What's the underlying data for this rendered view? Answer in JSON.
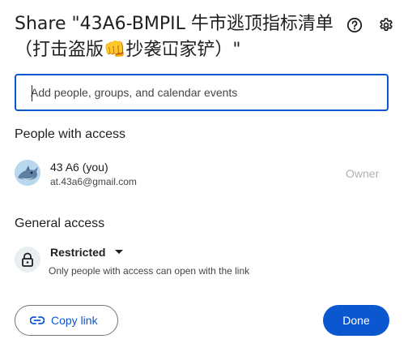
{
  "dialog": {
    "title": "Share \"43A6-BMPIL 牛市逃顶指标清单（打击盗版👊抄袭冚家铲）\"",
    "help_icon": "help-circle-icon",
    "settings_icon": "gear-icon"
  },
  "share_input": {
    "placeholder": "Add people, groups, and calendar events",
    "value": ""
  },
  "people_access": {
    "heading": "People with access",
    "people": [
      {
        "name": "43 A6 (you)",
        "email": "at.43a6@gmail.com",
        "role": "Owner",
        "avatar_icon": "shark-avatar-icon"
      }
    ]
  },
  "general_access": {
    "heading": "General access",
    "selected": "Restricted",
    "description": "Only people with access can open with the link",
    "icon": "lock-icon"
  },
  "footer": {
    "copy_link_label": "Copy link",
    "copy_link_icon": "link-icon",
    "done_label": "Done"
  },
  "colors": {
    "accent": "#0b57d0",
    "muted": "#b0b0b0",
    "lock_bg": "#e9eef1"
  }
}
